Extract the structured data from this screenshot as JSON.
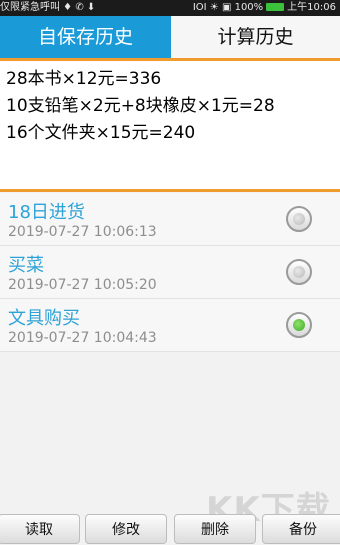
{
  "status_bar": {
    "left_text": "仅限紧急呼叫 ♦ ✆ ⬇",
    "right_text": "IOI ☀ ▣ 100%",
    "time": "上午10:06"
  },
  "tabs": [
    {
      "label": "自保存历史",
      "active": true
    },
    {
      "label": "计算历史",
      "active": false
    }
  ],
  "calc_lines": [
    "28本书×12元=336",
    "10支铅笔×2元+8块橡皮×1元=28",
    "16个文件夹×15元=240"
  ],
  "records": [
    {
      "title": "18日进货",
      "time": "2019-07-27 10:06:13",
      "selected": false
    },
    {
      "title": "买菜",
      "time": "2019-07-27 10:05:20",
      "selected": false
    },
    {
      "title": "文具购买",
      "time": "2019-07-27 10:04:43",
      "selected": true
    }
  ],
  "buttons": {
    "read": "读取",
    "edit": "修改",
    "delete": "删除",
    "backup": "备份"
  },
  "watermark": "KK下载",
  "colors": {
    "tab_active": "#1a9bd7",
    "accent_border": "#ef9b2d",
    "record_title": "#2ea3d8",
    "radio_selected": "#3ea92b"
  },
  "icons": {
    "radio_unselected": "radio-unselected-icon",
    "radio_selected": "radio-selected-icon"
  }
}
